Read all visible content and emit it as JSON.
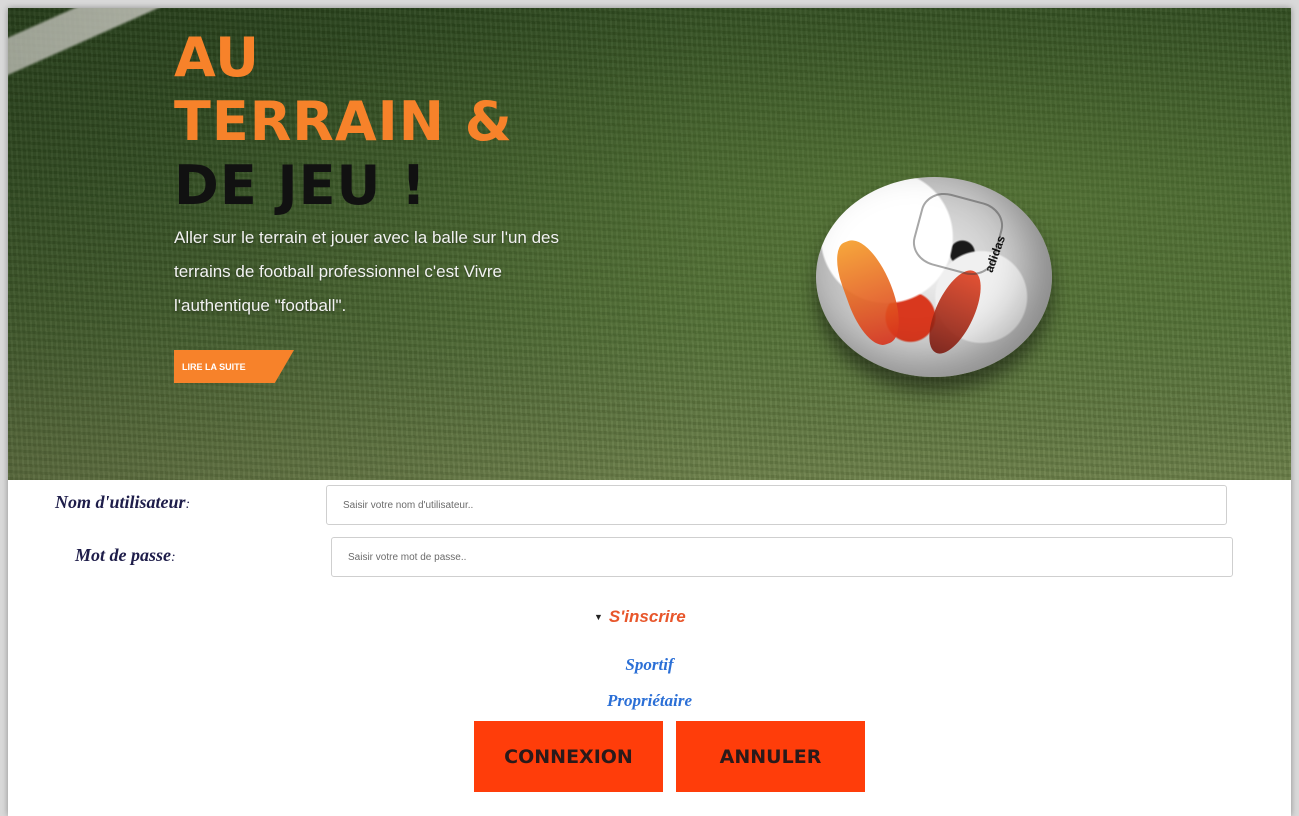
{
  "hero": {
    "title_line1": "AU",
    "title_line2": "TERRAIN &",
    "title_line3": "DE JEU !",
    "description": "Aller sur le terrain et jouer avec la balle sur l'un des terrains de football professionnel c'est Vivre l'authentique \"football\".",
    "read_more_label": "LIRE LA SUITE",
    "read_more_arrow": "›",
    "ball_brand": "adidas",
    "accent_color": "#f7822a"
  },
  "form": {
    "username_label": "Nom d'utilisateur",
    "username_placeholder": "Saisir votre nom d'utilisateur..",
    "password_label": "Mot de passe",
    "password_placeholder": "Saisir votre mot de passe..",
    "colon": ":"
  },
  "signup": {
    "caret": "▼",
    "label": "S'inscrire",
    "options": [
      "Sportif",
      "Propriétaire"
    ]
  },
  "buttons": {
    "login": "CONNEXION",
    "cancel": "ANNULER",
    "color": "#ff3d0a"
  }
}
